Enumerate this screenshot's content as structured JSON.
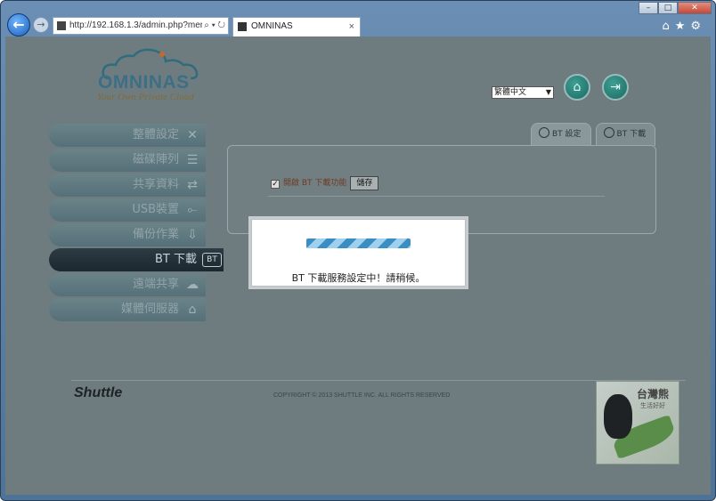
{
  "browser": {
    "url": "http://192.168.1.3/admin.php?mer",
    "address_icons": "⌕ ▾ ↻",
    "tab_title": "OMNINAS",
    "tab_close": "×",
    "back_icon": "←",
    "forward_icon": "→",
    "window_buttons": [
      "–",
      "□",
      "✕"
    ],
    "tools": "⌂★⚙"
  },
  "header": {
    "logo_text": "OMNINAS",
    "logo_tagline": "Your Own Private Cloud",
    "language": "繁體中文",
    "home_icon": "⌂",
    "logout_icon": "⇥"
  },
  "menu": {
    "items": [
      {
        "label": "整體設定",
        "icon": "✕"
      },
      {
        "label": "磁碟陣列",
        "icon": "☰"
      },
      {
        "label": "共享資料",
        "icon": "⇄"
      },
      {
        "label": "USB裝置",
        "icon": "⟜"
      },
      {
        "label": "備份作業",
        "icon": "⇩"
      },
      {
        "label": "BT 下載",
        "icon": "BT"
      },
      {
        "label": "遠端共享",
        "icon": "☁"
      },
      {
        "label": "媒體伺服器",
        "icon": "⌂"
      }
    ]
  },
  "panel": {
    "tabs": [
      "BT 設定",
      "BT 下載"
    ],
    "enable_bt_label": "開啟 BT 下載功能",
    "checkbox_mark": "✓",
    "save_button": "儲存"
  },
  "modal": {
    "message": "BT 下載服務設定中！請稍候。"
  },
  "footer": {
    "brand": "Shuttle",
    "copyright": "COPYRIGHT © 2013 SHUTTLE INC. ALL RIGHTS RESERVED",
    "badge_title": "台灣熊",
    "badge_subtitle": "生活好好"
  }
}
